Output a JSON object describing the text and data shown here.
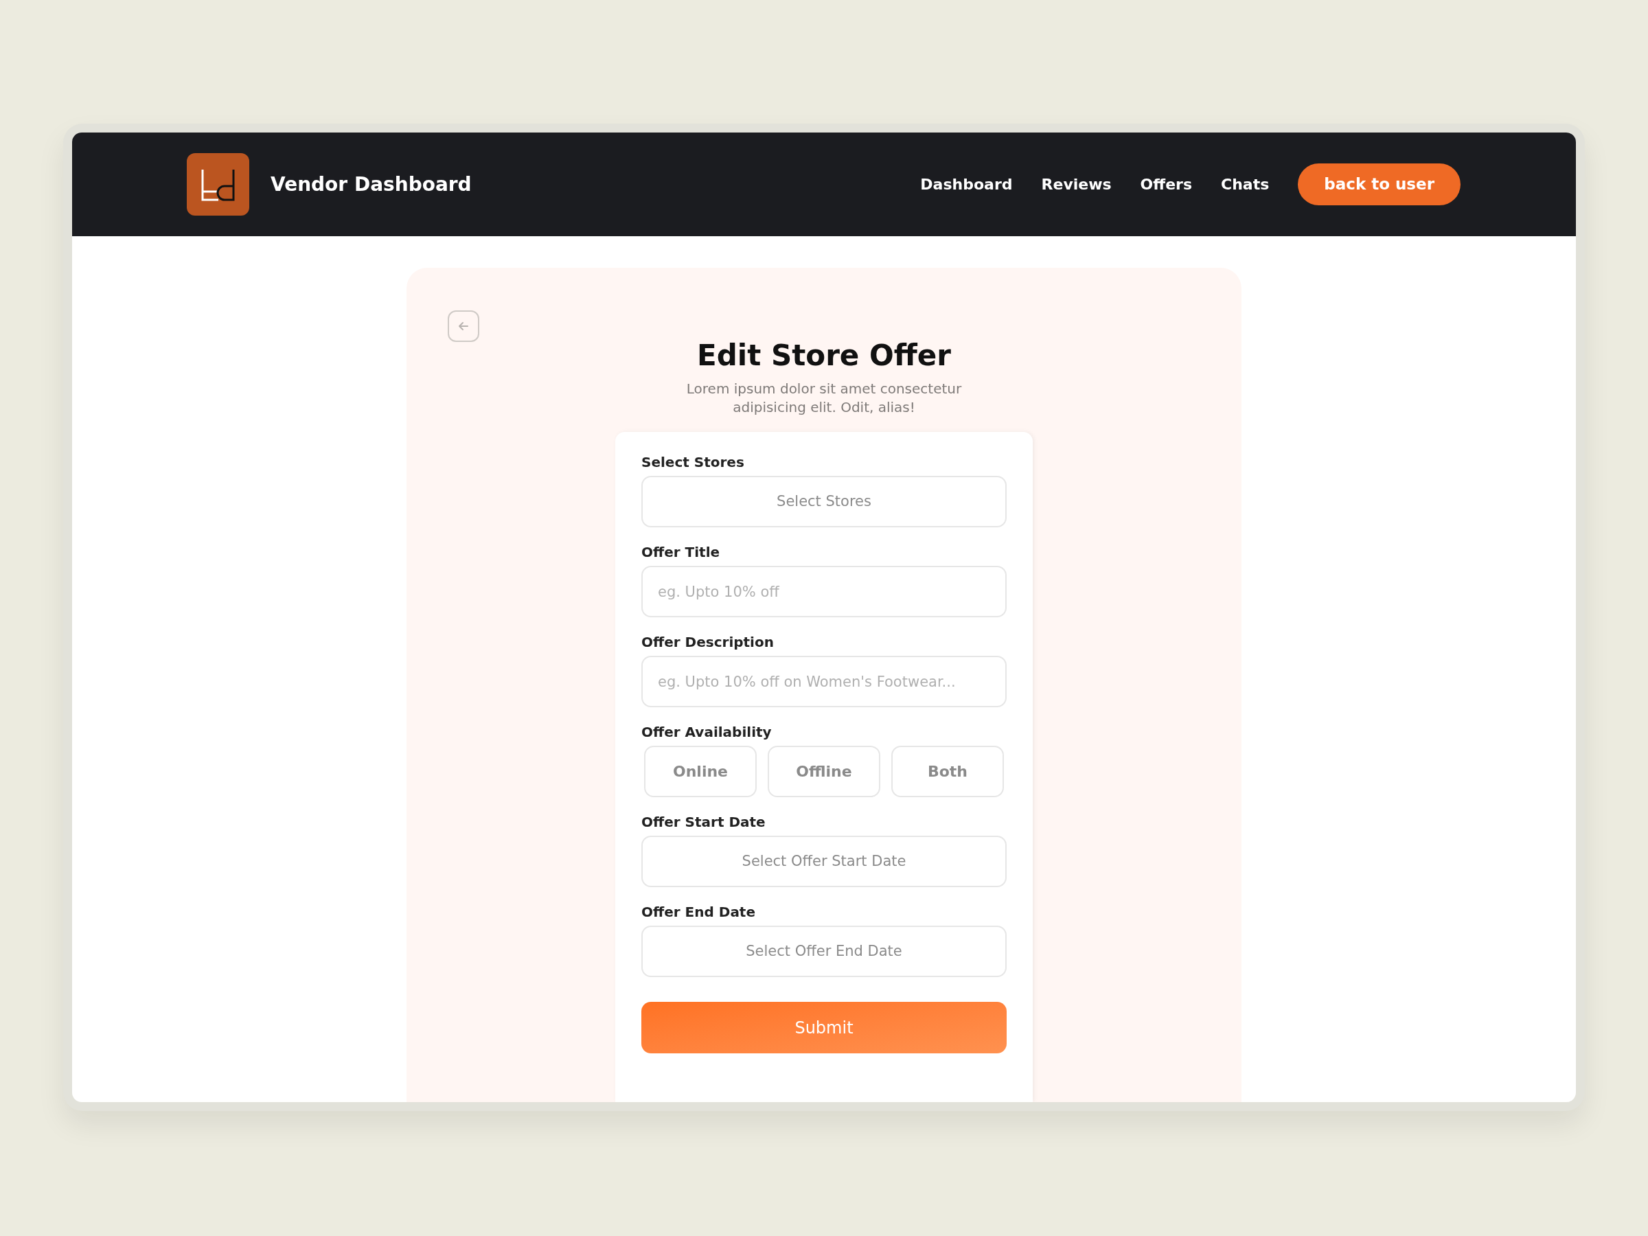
{
  "header": {
    "title": "Vendor Dashboard",
    "nav": [
      {
        "label": "Dashboard"
      },
      {
        "label": "Reviews"
      },
      {
        "label": "Offers"
      },
      {
        "label": "Chats"
      }
    ],
    "action": "back to user"
  },
  "page": {
    "title": "Edit Store Offer",
    "subtitle": "Lorem ipsum dolor sit amet consectetur adipisicing elit. Odit, alias!"
  },
  "form": {
    "fields": [
      {
        "kind": "select",
        "label": "Select Stores",
        "placeholder": "Select Stores"
      },
      {
        "kind": "text",
        "label": "Offer Title",
        "placeholder": "eg. Upto 10% off"
      },
      {
        "kind": "text",
        "label": "Offer Description",
        "placeholder": "eg. Upto 10% off on Women's Footwear..."
      },
      {
        "kind": "options",
        "label": "Offer Availability",
        "options": [
          {
            "label": "Online",
            "selected": false
          },
          {
            "label": "Offline",
            "selected": false
          },
          {
            "label": "Both",
            "selected": false
          }
        ]
      },
      {
        "kind": "select",
        "label": "Offer Start Date",
        "placeholder": "Select Offer Start Date"
      },
      {
        "kind": "select",
        "label": "Offer End Date",
        "placeholder": "Select Offer End Date"
      }
    ],
    "submit": "Submit"
  }
}
